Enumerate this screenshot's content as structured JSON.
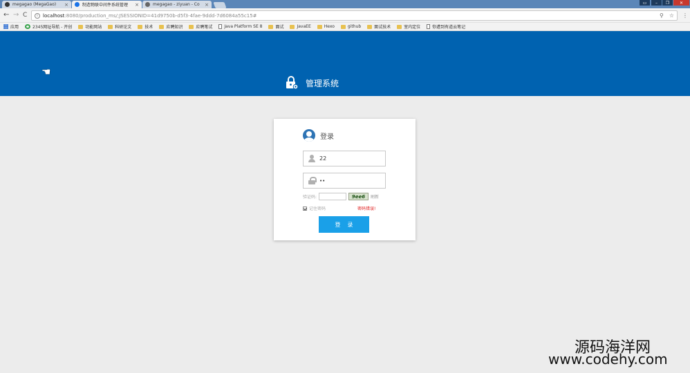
{
  "tabs": [
    {
      "title": "megagao (MegaGao)",
      "favicon": "github-icon"
    },
    {
      "title": "制造物联中间件系统管理",
      "favicon": "chrome-page-icon",
      "active": true
    },
    {
      "title": "megagao - ziyuan - Co",
      "favicon": "cloud-icon"
    }
  ],
  "tab_close": "×",
  "window_controls": [
    "▭",
    "–",
    "❐",
    "✕"
  ],
  "nav": {
    "back": "←",
    "forward": "→",
    "reload": "C"
  },
  "address": {
    "host": "localhost",
    "rest": ":8080/production_ms/;JSESSIONID=41d9750b-d5f3-4fae-9ddd-7d6084a55c15#",
    "info": "i"
  },
  "omni_icons": [
    "⚲",
    "☆"
  ],
  "menu": "⋮",
  "bookmarks": [
    {
      "label": "应用",
      "type": "apps"
    },
    {
      "label": "2345网址导航 - 开创",
      "type": "site"
    },
    {
      "label": "功能网站",
      "type": "folder"
    },
    {
      "label": "科研论文",
      "type": "folder"
    },
    {
      "label": "技术",
      "type": "folder"
    },
    {
      "label": "应聘知识",
      "type": "folder"
    },
    {
      "label": "应聘笔试",
      "type": "folder"
    },
    {
      "label": "Java Platform SE 8",
      "type": "page"
    },
    {
      "label": "面试",
      "type": "folder"
    },
    {
      "label": "JavaEE",
      "type": "folder"
    },
    {
      "label": "Hexo",
      "type": "folder"
    },
    {
      "label": "github",
      "type": "folder"
    },
    {
      "label": "面试技术",
      "type": "folder"
    },
    {
      "label": "室内定位",
      "type": "folder"
    },
    {
      "label": "你遭到有道云笔记",
      "type": "page"
    }
  ],
  "header": {
    "title": "管理系统",
    "pointer": "☚"
  },
  "login": {
    "title": "登录",
    "username": "22",
    "password": "••",
    "captcha_label": "验证码:",
    "captcha_text": "9ee6",
    "refresh": "刷新",
    "remember": "记住密码",
    "error": "密码错误!",
    "submit": "登录"
  },
  "watermark": {
    "line1": "源码海洋网",
    "line2": "www.codehy.com"
  },
  "colors": {
    "header": "#0062b0",
    "button": "#1aa0e8",
    "error": "#e02020"
  }
}
